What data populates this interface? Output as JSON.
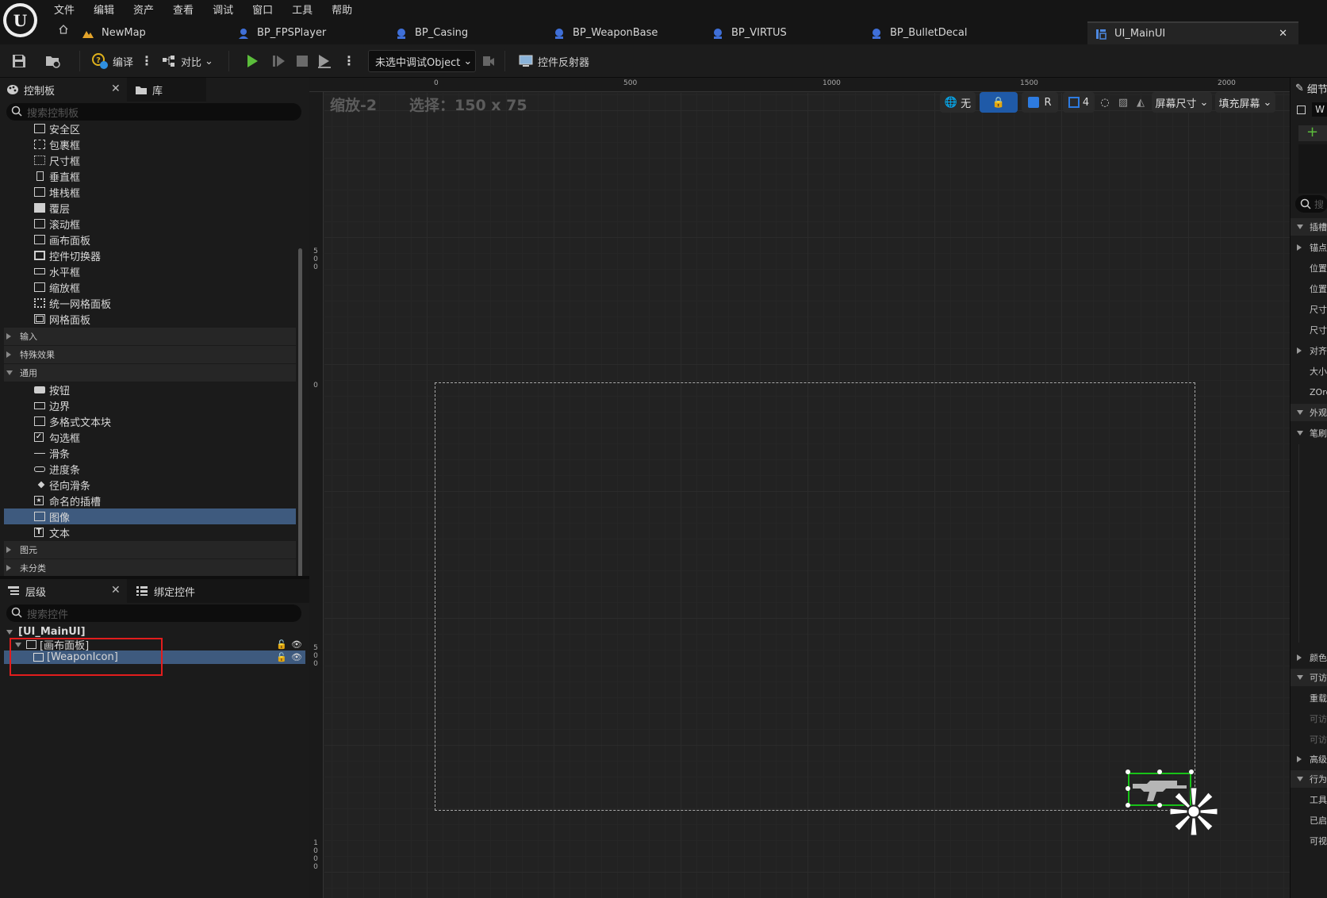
{
  "menu": [
    "文件",
    "编辑",
    "资产",
    "查看",
    "调试",
    "窗口",
    "工具",
    "帮助"
  ],
  "tabs": [
    {
      "label": "NewMap",
      "icon": "level-icon"
    },
    {
      "label": "BP_FPSPlayer",
      "icon": "blueprint-icon"
    },
    {
      "label": "BP_Casing",
      "icon": "blueprint-icon"
    },
    {
      "label": "BP_WeaponBase",
      "icon": "blueprint-icon"
    },
    {
      "label": "BP_VIRTUS",
      "icon": "blueprint-icon"
    },
    {
      "label": "BP_BulletDecal",
      "icon": "blueprint-icon"
    },
    {
      "label": "UI_MainUI",
      "icon": "widget-blueprint-icon",
      "active": true
    }
  ],
  "toolbar": {
    "compile_label": "编译",
    "diff_label": "对比",
    "debug_object": "未选中调试Object",
    "reflector_label": "控件反射器"
  },
  "palette": {
    "tab_label": "控制板",
    "library_tab": "库",
    "search_placeholder": "搜索控制板",
    "items_top": [
      {
        "label": "安全区",
        "icon": "safe-zone-icon"
      },
      {
        "label": "包裹框",
        "icon": "wrap-box-icon"
      },
      {
        "label": "尺寸框",
        "icon": "size-box-icon"
      },
      {
        "label": "垂直框",
        "icon": "vertical-box-icon"
      },
      {
        "label": "堆栈框",
        "icon": "stack-box-icon"
      },
      {
        "label": "覆层",
        "icon": "overlay-icon"
      },
      {
        "label": "滚动框",
        "icon": "scroll-box-icon"
      },
      {
        "label": "画布面板",
        "icon": "canvas-panel-icon"
      },
      {
        "label": "控件切换器",
        "icon": "widget-switcher-icon"
      },
      {
        "label": "水平框",
        "icon": "horizontal-box-icon"
      },
      {
        "label": "缩放框",
        "icon": "scale-box-icon"
      },
      {
        "label": "统一网格面板",
        "icon": "uniform-grid-icon"
      },
      {
        "label": "网格面板",
        "icon": "grid-panel-icon"
      }
    ],
    "categories": {
      "input": "输入",
      "effects": "特殊效果",
      "common": "通用",
      "primitive": "图元",
      "uncategorized": "未分类"
    },
    "items_common": [
      {
        "label": "按钮",
        "icon": "button-icon"
      },
      {
        "label": "边界",
        "icon": "border-icon"
      },
      {
        "label": "多格式文本块",
        "icon": "rich-text-icon"
      },
      {
        "label": "勾选框",
        "icon": "checkbox-icon"
      },
      {
        "label": "滑条",
        "icon": "slider-icon"
      },
      {
        "label": "进度条",
        "icon": "progress-bar-icon"
      },
      {
        "label": "径向滑条",
        "icon": "radial-slider-icon"
      },
      {
        "label": "命名的插槽",
        "icon": "named-slot-icon"
      },
      {
        "label": "图像",
        "icon": "image-icon",
        "selected": true
      },
      {
        "label": "文本",
        "icon": "text-icon"
      }
    ]
  },
  "hierarchy": {
    "tab_label": "层级",
    "bind_tab": "绑定控件",
    "search_placeholder": "搜索控件",
    "root": "[UI_MainUI]",
    "canvas": "[画布面板]",
    "child": "[WeaponIcon]"
  },
  "designer": {
    "zoom": "缩放-2",
    "selection": "选择：150 x 75",
    "ruler_top": [
      "0",
      "500",
      "1000",
      "1500",
      "2000"
    ],
    "ruler_left": [
      "5 0 0",
      "0",
      "5 0 0",
      "1 0 0 0"
    ],
    "none_label": "无",
    "r_label": "R",
    "grid_value": "4",
    "screen_size": "屏幕尺寸",
    "fill_screen": "填充屏幕"
  },
  "details": {
    "tab_label": "细节",
    "name_field": "W",
    "search_placeholder": "搜",
    "rows": [
      {
        "label": "插槽",
        "expanded": true
      },
      {
        "label": "锚点",
        "expanded": false
      },
      {
        "label": "位置",
        "indent": true
      },
      {
        "label": "位置",
        "indent": true
      },
      {
        "label": "尺寸",
        "indent": true
      },
      {
        "label": "尺寸",
        "indent": true
      },
      {
        "label": "对齐",
        "expanded": false
      },
      {
        "label": "大小",
        "indent": true
      },
      {
        "label": "ZOrder",
        "indent": true
      },
      {
        "label": "外观",
        "expanded": true
      },
      {
        "label": "笔刷",
        "expanded": true
      },
      {
        "label": "颜色",
        "expanded": false
      },
      {
        "label": "可访",
        "expanded": true
      },
      {
        "label": "重载",
        "indent": true
      },
      {
        "label": "可访",
        "indent": true
      },
      {
        "label": "可访",
        "indent": true
      },
      {
        "label": "高级",
        "expanded": false
      },
      {
        "label": "行为",
        "expanded": true
      },
      {
        "label": "工具",
        "indent": true
      },
      {
        "label": "已启",
        "indent": true
      },
      {
        "label": "可视",
        "indent": true
      }
    ]
  },
  "colors": {
    "accent": "#3e5a7e",
    "selection_green": "#18c218",
    "highlight_red": "#e21d1d",
    "play_green": "#5bbd3b"
  }
}
